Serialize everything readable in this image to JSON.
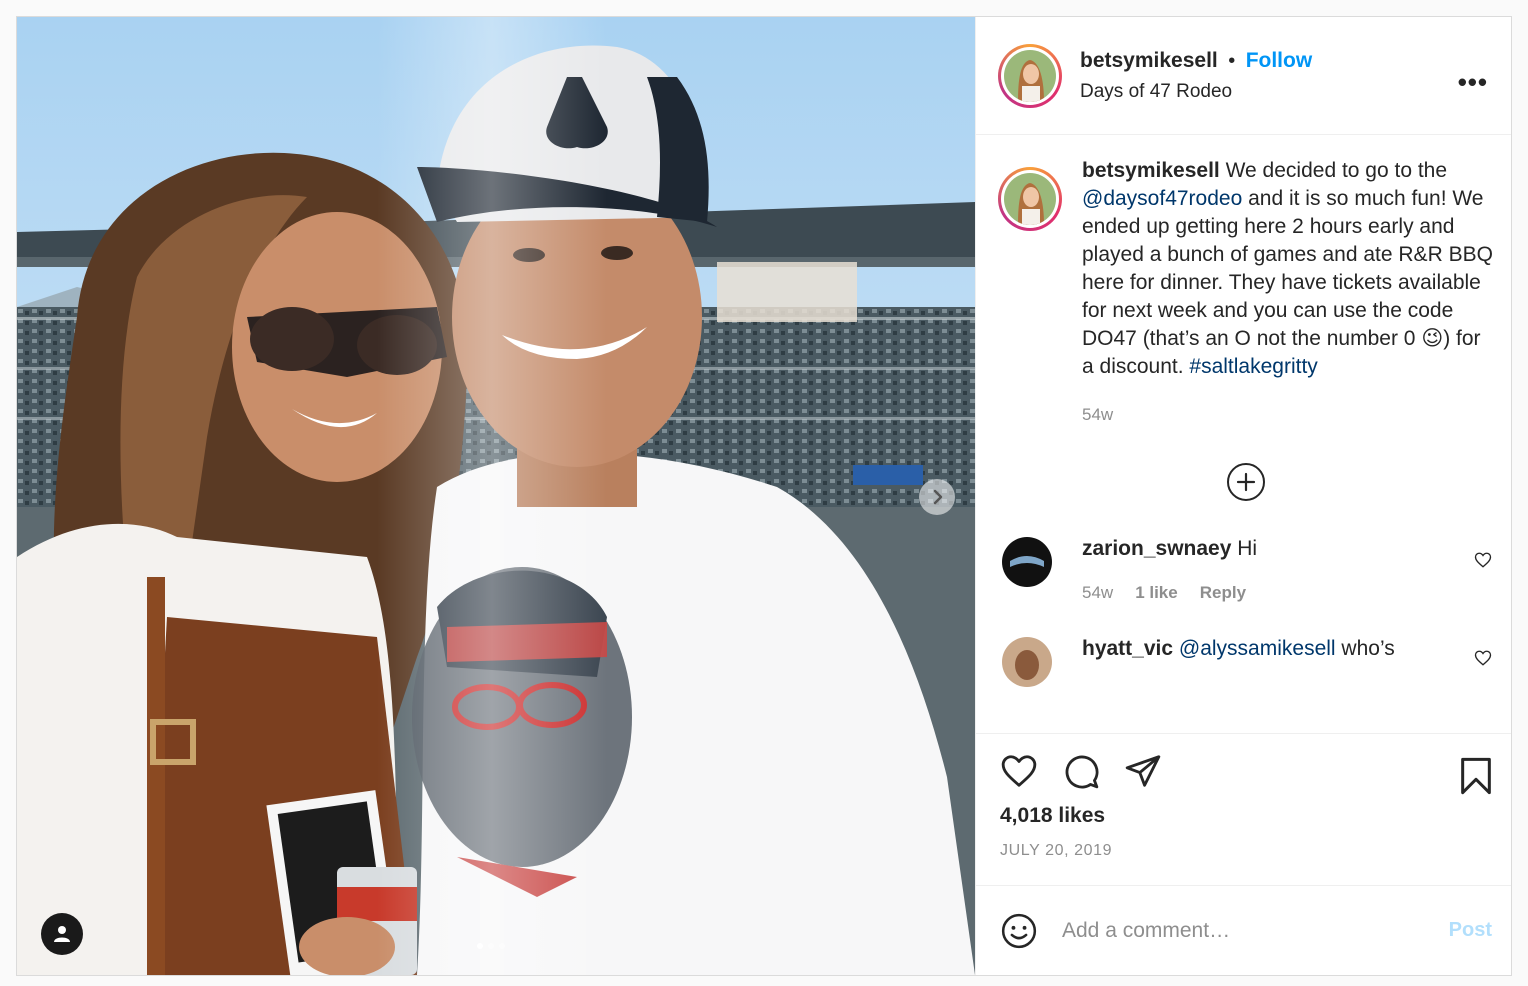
{
  "post": {
    "username": "betsymikesell",
    "follow_label": "Follow",
    "separator": "•",
    "location": "Days of 47 Rodeo",
    "more_label": "•••",
    "caption": {
      "username": "betsymikesell",
      "text_1": " We decided to go to the ",
      "mention": "@daysof47rodeo",
      "text_2": " and it is so much fun! We ended up getting here 2 hours early and played a bunch of games and ate R&R BBQ here for dinner. They have tickets available for next week and you can use the code DO47 (that’s an O not the number 0 ",
      "emoji": "😉",
      "text_3": ") for a discount. ",
      "hashtag": "#saltlakegritty",
      "ago": "54w"
    },
    "comments": [
      {
        "username": "zarion_swnaey",
        "text": " Hi",
        "ago": "54w",
        "likes": "1 like",
        "reply": "Reply"
      },
      {
        "username": "hyatt_vic",
        "mention": "@alyssamikesell",
        "text": " who’s"
      }
    ],
    "likes": "4,018 likes",
    "date": "JULY 20, 2019",
    "comment_placeholder": "Add a comment…",
    "post_label": "Post",
    "icons": [
      "heart-icon",
      "comment-icon",
      "share-icon",
      "bookmark-icon",
      "emoji-icon",
      "plus-circle-icon",
      "chevron-right-icon",
      "user-tag-icon"
    ],
    "colors": {
      "accent": "#0095f6",
      "link": "#00376b",
      "muted": "#8e8e8e",
      "post_disabled": "#b2dffc"
    }
  }
}
